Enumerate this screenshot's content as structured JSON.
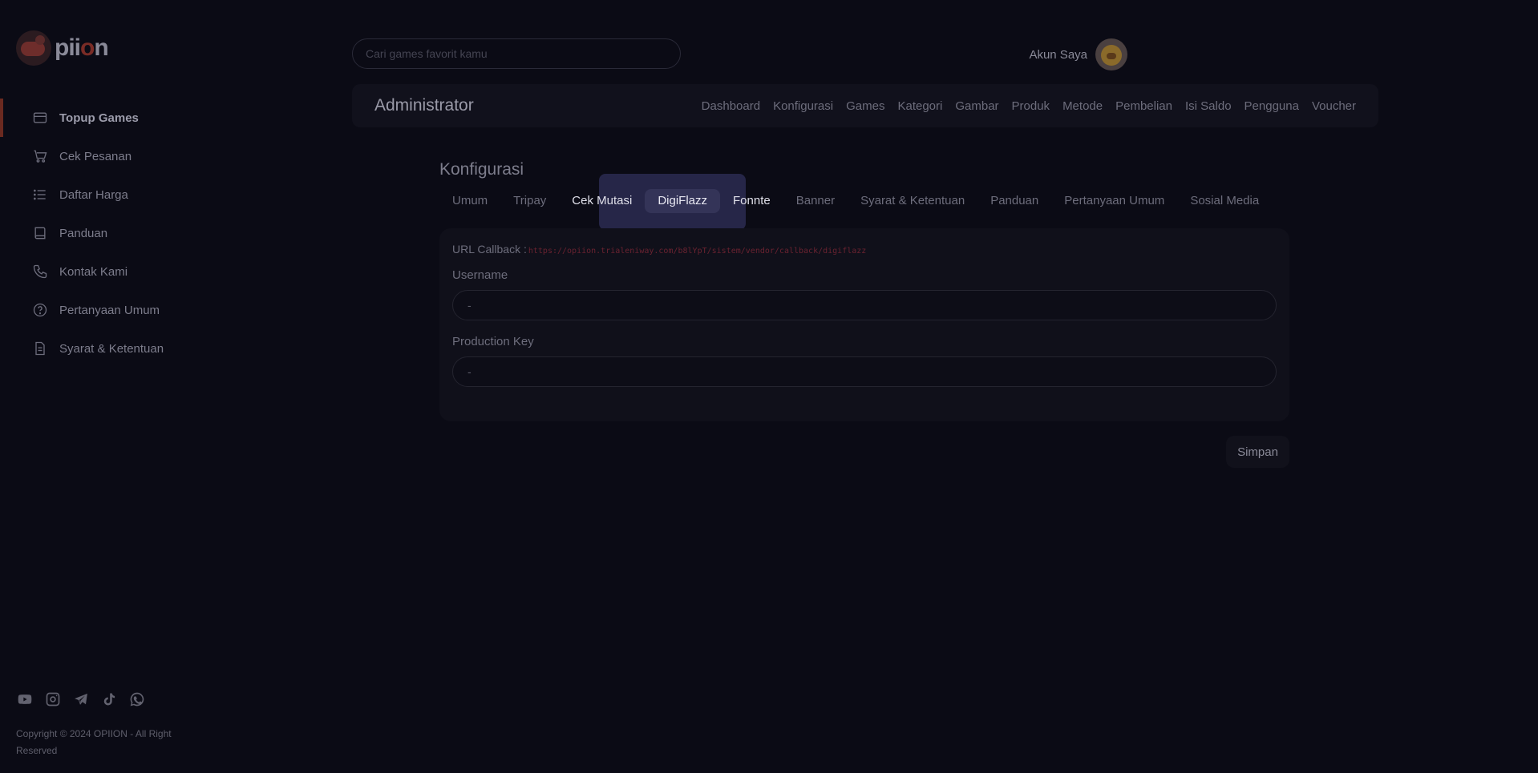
{
  "brand": {
    "name_prefix": "pii",
    "name_o": "o",
    "name_suffix": "n"
  },
  "sidebar": {
    "items": [
      {
        "label": "Topup Games",
        "icon": "credit-card-icon",
        "active": true
      },
      {
        "label": "Cek Pesanan",
        "icon": "cart-icon"
      },
      {
        "label": "Daftar Harga",
        "icon": "list-icon"
      },
      {
        "label": "Panduan",
        "icon": "book-icon"
      },
      {
        "label": "Kontak Kami",
        "icon": "phone-icon"
      },
      {
        "label": "Pertanyaan Umum",
        "icon": "question-icon"
      },
      {
        "label": "Syarat & Ketentuan",
        "icon": "document-icon"
      }
    ],
    "socials": [
      "youtube-icon",
      "instagram-icon",
      "telegram-icon",
      "tiktok-icon",
      "whatsapp-icon"
    ],
    "copyright": "Copyright © 2024 OPIION - All Right Reserved"
  },
  "header": {
    "search_placeholder": "Cari games favorit kamu",
    "account_label": "Akun Saya"
  },
  "admin": {
    "title": "Administrator",
    "links": [
      "Dashboard",
      "Konfigurasi",
      "Games",
      "Kategori",
      "Gambar",
      "Produk",
      "Metode",
      "Pembelian",
      "Isi Saldo",
      "Pengguna",
      "Voucher"
    ]
  },
  "config": {
    "title": "Konfigurasi",
    "tabs": [
      "Umum",
      "Tripay",
      "Cek Mutasi",
      "DigiFlazz",
      "Fonnte",
      "Banner",
      "Syarat & Ketentuan",
      "Panduan",
      "Pertanyaan Umum",
      "Sosial Media"
    ],
    "active_tab": "DigiFlazz",
    "callback_label": "URL Callback :",
    "callback_url": "https://opiion.trialeniway.com/b8lYpT/sistem/vendor/callback/digiflazz",
    "username_label": "Username",
    "username_value": "-",
    "key_label": "Production Key",
    "key_value": "-",
    "save_label": "Simpan"
  }
}
